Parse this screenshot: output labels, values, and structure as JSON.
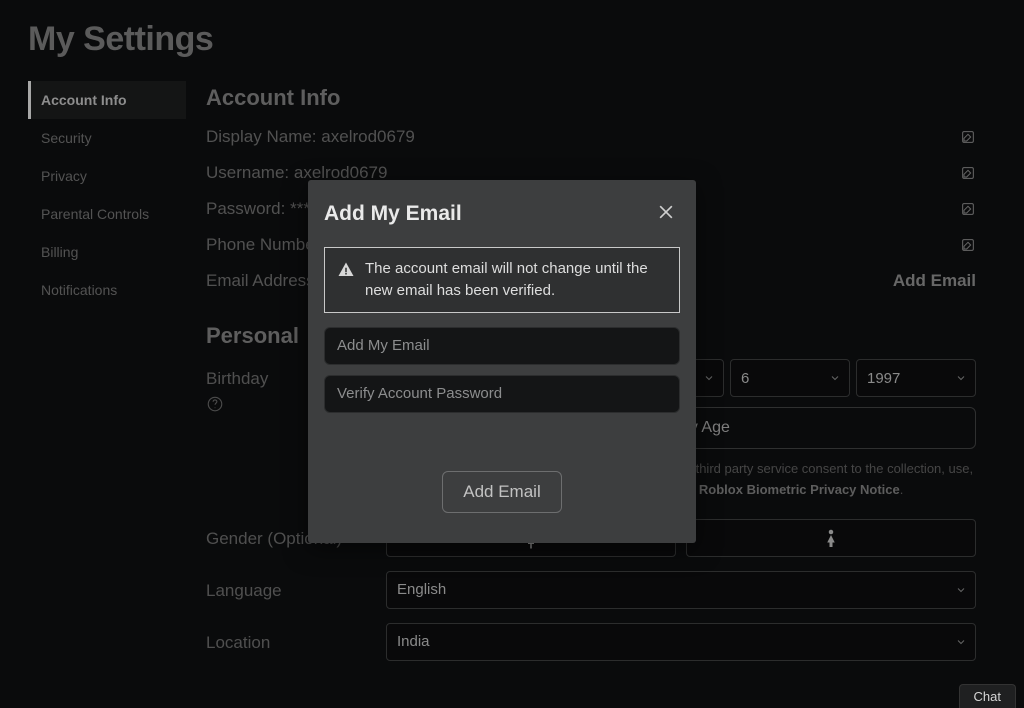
{
  "page_title": "My Settings",
  "sidebar": {
    "items": [
      {
        "label": "Account Info",
        "active": true
      },
      {
        "label": "Security"
      },
      {
        "label": "Privacy"
      },
      {
        "label": "Parental Controls"
      },
      {
        "label": "Billing"
      },
      {
        "label": "Notifications"
      }
    ]
  },
  "account": {
    "section_title": "Account Info",
    "display_name_label": "Display Name:",
    "display_name_value": "axelrod0679",
    "username_label": "Username:",
    "username_value": "axelrod0679",
    "password_label": "Password:",
    "password_value": "*********",
    "phone_label": "Phone Number:",
    "phone_value": "",
    "email_label": "Email Address:",
    "email_action": "Add Email"
  },
  "personal": {
    "section_title": "Personal",
    "birthday_label": "Birthday",
    "month": "",
    "day": "6",
    "year": "1997",
    "verify_button": "Verify My Age",
    "verify_note_prefix": "My Age' you will be completing an ID operated by our third party service consent to the collection, use, and sharing of your biometric data as described in the ",
    "verify_note_link": "Roblox Biometric Privacy Notice",
    "verify_note_suffix": ".",
    "gender_label": "Gender (Optional)",
    "language_label": "Language",
    "language_value": "English",
    "location_label": "Location",
    "location_value": "India"
  },
  "modal": {
    "title": "Add My Email",
    "warning": "The account email will not change until the new email has been verified.",
    "email_placeholder": "Add My Email",
    "password_placeholder": "Verify Account Password",
    "submit": "Add Email"
  },
  "chat_label": "Chat"
}
